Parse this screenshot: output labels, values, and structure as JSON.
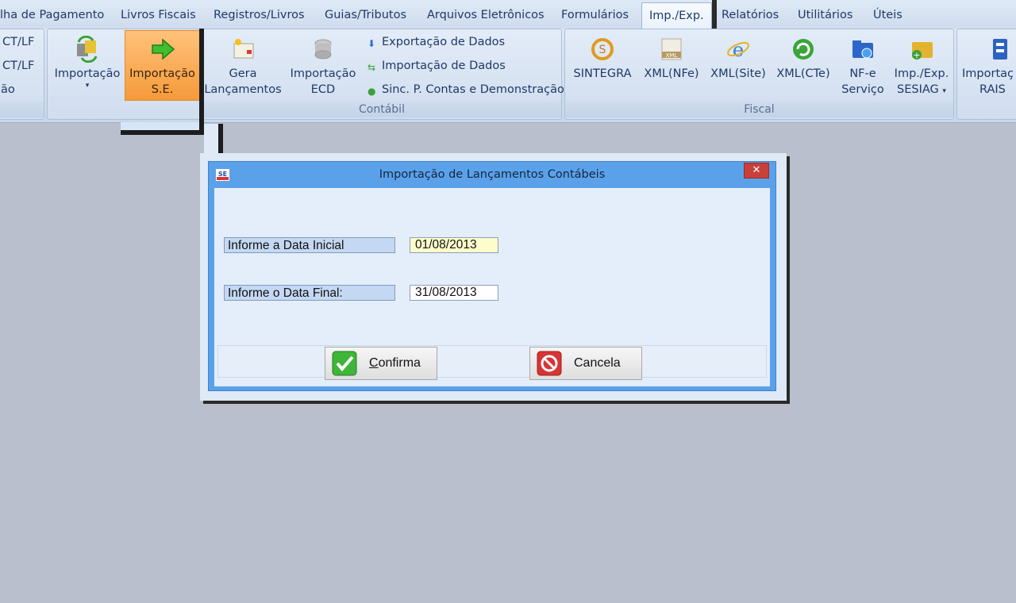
{
  "tabs": [
    {
      "label": "lha de Pagamento"
    },
    {
      "label": "Livros Fiscais"
    },
    {
      "label": "Registros/Livros"
    },
    {
      "label": "Guias/Tributos"
    },
    {
      "label": "Arquivos Eletrônicos"
    },
    {
      "label": "Formulários"
    },
    {
      "label": "Imp./Exp.",
      "active": true
    },
    {
      "label": "Relatórios"
    },
    {
      "label": "Utilitários"
    },
    {
      "label": "Úteis"
    }
  ],
  "ribbon": {
    "left_partial": {
      "line1": "CT/LF",
      "line2": "CT/LF",
      "line3": "ão"
    },
    "import_group": {
      "importacao": "Importação",
      "importacao_se_1": "Importação",
      "importacao_se_2": "S.E."
    },
    "contabil": {
      "label": "Contábil",
      "gera_1": "Gera",
      "gera_2": "Lançamentos",
      "ecd_1": "Importação",
      "ecd_2": "ECD",
      "exportacao": "Exportação de Dados",
      "importacao_dados": "Importação de Dados",
      "sinc": "Sinc. P. Contas e Demonstração"
    },
    "fiscal": {
      "label": "Fiscal",
      "sintegra": "SINTEGRA",
      "xml_nfe": "XML(NFe)",
      "xml_nfe_icon_text": "XML",
      "xml_site": "XML(Site)",
      "xml_cte": "XML(CTe)",
      "nfe_1": "NF-e",
      "nfe_2": "Serviço",
      "sesiag_1": "Imp./Exp.",
      "sesiag_2": "SESIAG"
    },
    "rais": {
      "line1": "Importaç",
      "line2": "RAIS"
    }
  },
  "dialog": {
    "title": "Importação de Lançamentos Contábeis",
    "logo_text": "SE",
    "close": "✕",
    "label_inicial": "Informe a Data Inicial",
    "value_inicial": "01/08/2013",
    "label_final": "Informe o Data Final:",
    "value_final": "31/08/2013",
    "confirma_first": "C",
    "confirma_rest": "onfirma",
    "cancela": "Cancela"
  },
  "colors": {
    "background": "#b9bfcc",
    "hot_button": "#f59a3a",
    "dialog_frame": "#5ba1ea",
    "focus_field": "#fdfdcc"
  }
}
